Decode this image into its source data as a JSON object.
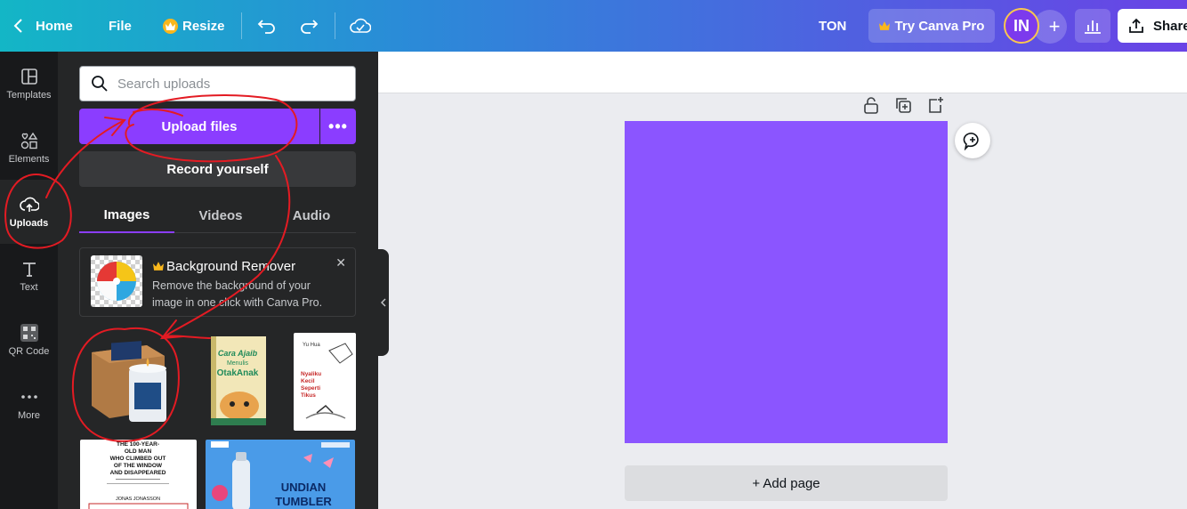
{
  "topbar": {
    "back_icon": "chevron-left-icon",
    "home_label": "Home",
    "file_label": "File",
    "resize_label": "Resize",
    "resize_icon": "crown-icon",
    "undo_icon": "undo-icon",
    "redo_icon": "redo-icon",
    "cloud_icon": "cloud-saved-icon",
    "doc_title": "TON",
    "try_pro_label": "Try Canva Pro",
    "avatar_initials": "IN",
    "add_icon": "plus-icon",
    "analytics_icon": "bar-chart-icon",
    "share_label": "Share"
  },
  "rail": {
    "items": [
      {
        "label": "Templates",
        "icon": "templates-icon"
      },
      {
        "label": "Elements",
        "icon": "elements-icon"
      },
      {
        "label": "Uploads",
        "icon": "cloud-upload-icon"
      },
      {
        "label": "Text",
        "icon": "text-icon"
      },
      {
        "label": "QR Code",
        "icon": "qr-code-icon"
      },
      {
        "label": "More",
        "icon": "more-icon"
      }
    ],
    "active": "Uploads"
  },
  "panel": {
    "search_placeholder": "Search uploads",
    "upload_label": "Upload files",
    "upload_more_label": "•••",
    "record_label": "Record yourself",
    "tabs": [
      {
        "label": "Images"
      },
      {
        "label": "Videos"
      },
      {
        "label": "Audio"
      }
    ],
    "active_tab": "Images",
    "bg_remover": {
      "title": "Background Remover",
      "desc": "Remove the background of your image in one click with Canva Pro.",
      "close": "✕"
    },
    "uploads": [
      {
        "label": "candle-box-product"
      },
      {
        "label": "book-cara-ajaib",
        "title": "Cara Ajaib Menulis Otak Anak"
      },
      {
        "label": "book-nyaliku",
        "author": "Yu Hua",
        "title": "Nyaliku Kecil Seperti Tikus"
      },
      {
        "label": "book-100-year-old-man",
        "title": "THE 100-YEAR-OLD MAN WHO CLIMBED OUT OF THE WINDOW AND DISAPPEARED",
        "author": "JONAS JONASSON"
      },
      {
        "label": "undian-tumbler-poster",
        "title": "UNDIAN TUMBLER"
      }
    ]
  },
  "canvas": {
    "add_page_label": "+ Add page",
    "page_color": "#8b55ff"
  },
  "colors": {
    "accent": "#8b3dff",
    "panel_bg": "#252627",
    "rail_bg": "#18191b",
    "annotation": "#e31b23"
  }
}
